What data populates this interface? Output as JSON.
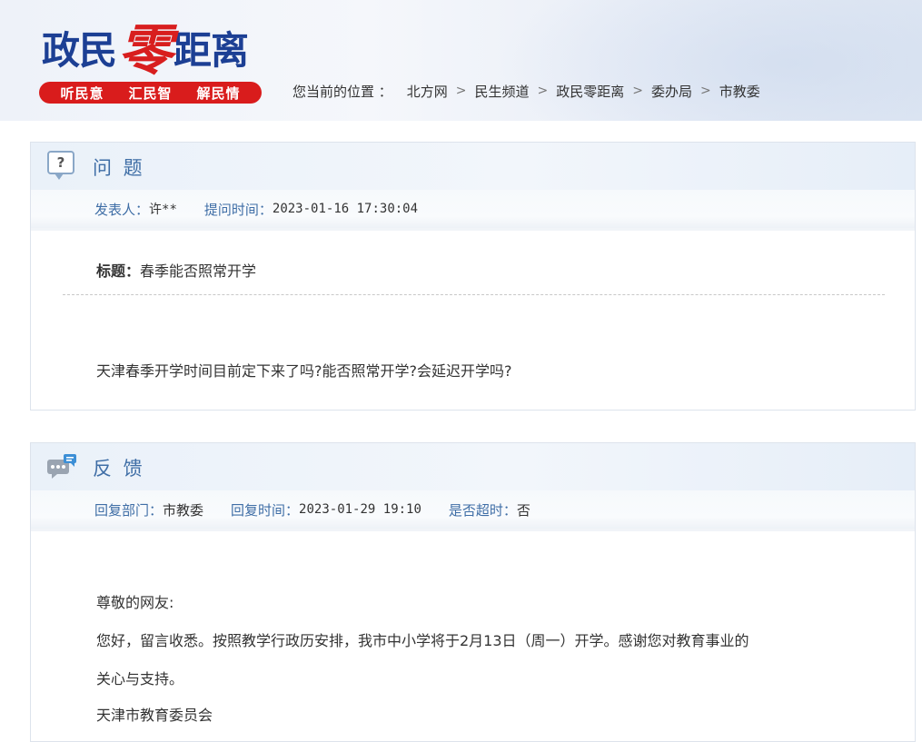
{
  "header": {
    "logo": {
      "part1": "政民",
      "part2": "零",
      "part3": "距离"
    },
    "slogans": [
      "听民意",
      "汇民智",
      "解民情"
    ],
    "breadcrumb_lead": "您当前的位置 ：",
    "breadcrumb": [
      "北方网",
      "民生频道",
      "政民零距离",
      "委办局",
      "市教委"
    ],
    "breadcrumb_sep": ">"
  },
  "question": {
    "title": "问 题",
    "poster_label": "发表人：",
    "poster_value": "许**",
    "time_label": "提问时间：",
    "time_value": "2023-01-16 17:30:04",
    "subject_label": "标题：",
    "subject_value": "春季能否照常开学",
    "content": "天津春季开学时间目前定下来了吗?能否照常开学?会延迟开学吗?"
  },
  "feedback": {
    "title": "反 馈",
    "dept_label": "回复部门：",
    "dept_value": "市教委",
    "time_label": "回复时间：",
    "time_value": "2023-01-29 19:10",
    "overtime_label": "是否超时：",
    "overtime_value": "否",
    "greeting": "尊敬的网友:",
    "line1": "您好，留言收悉。按照教学行政历安排，我市中小学将于2月13日（周一）开学。感谢您对教育事业的",
    "line2": "关心与支持。",
    "signature": "天津市教育委员会"
  },
  "colors": {
    "accent_blue": "#3f6ea6",
    "logo_blue": "#1c3f94",
    "logo_red": "#d81e1e"
  }
}
